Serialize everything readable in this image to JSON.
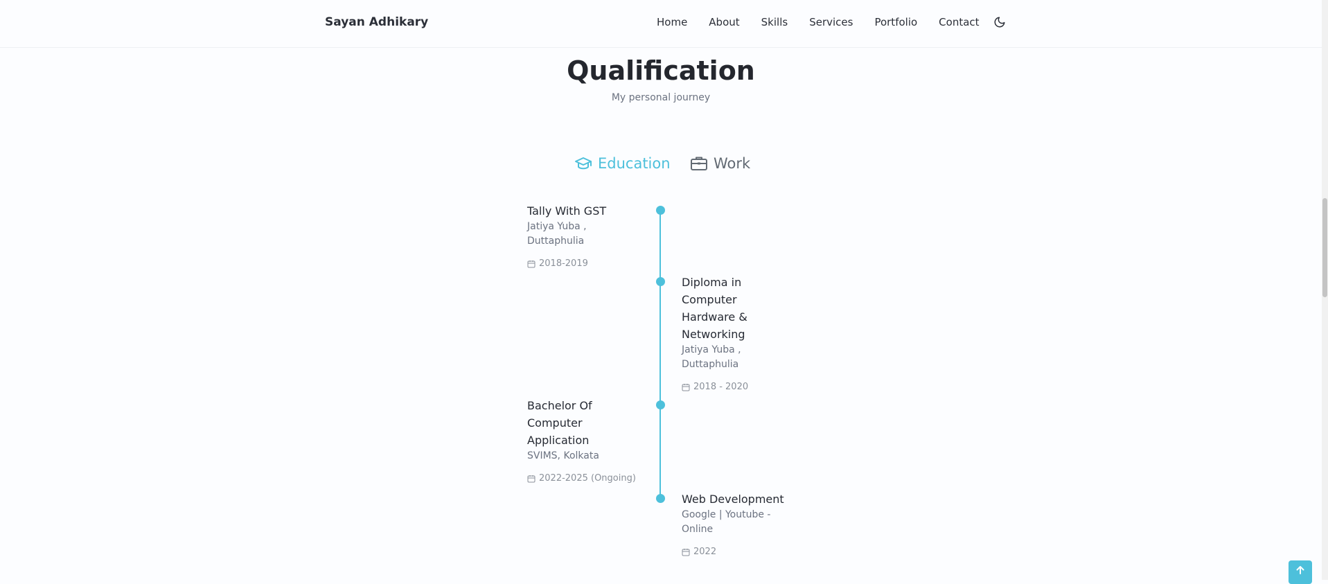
{
  "header": {
    "logo": "Sayan Adhikary",
    "nav": [
      "Home",
      "About",
      "Skills",
      "Services",
      "Portfolio",
      "Contact"
    ],
    "theme_icon": "moon-icon"
  },
  "section": {
    "title": "Qualification",
    "subtitle": "My personal journey"
  },
  "tabs": {
    "education": "Education",
    "work": "Work",
    "active": "education",
    "accent_color": "#4dc0db"
  },
  "timeline": [
    {
      "side": "left",
      "title": "Tally With GST",
      "subtitle": "Jatiya Yuba , Duttaphulia",
      "date": "2018-2019"
    },
    {
      "side": "right",
      "title": "Diploma in Computer Hardware & Networking",
      "subtitle": "Jatiya Yuba , Duttaphulia",
      "date": "2018 - 2020"
    },
    {
      "side": "left",
      "title": "Bachelor Of Computer Application",
      "subtitle": "SVIMS, Kolkata",
      "date": "2022-2025 (Ongoing)"
    },
    {
      "side": "right",
      "title": "Web Development",
      "subtitle": "Google | Youtube - Online",
      "date": "2022"
    }
  ],
  "icons": {
    "education": "graduation-cap-icon",
    "work": "briefcase-icon",
    "date": "calendar-icon",
    "scroll_up": "arrow-up-icon"
  }
}
